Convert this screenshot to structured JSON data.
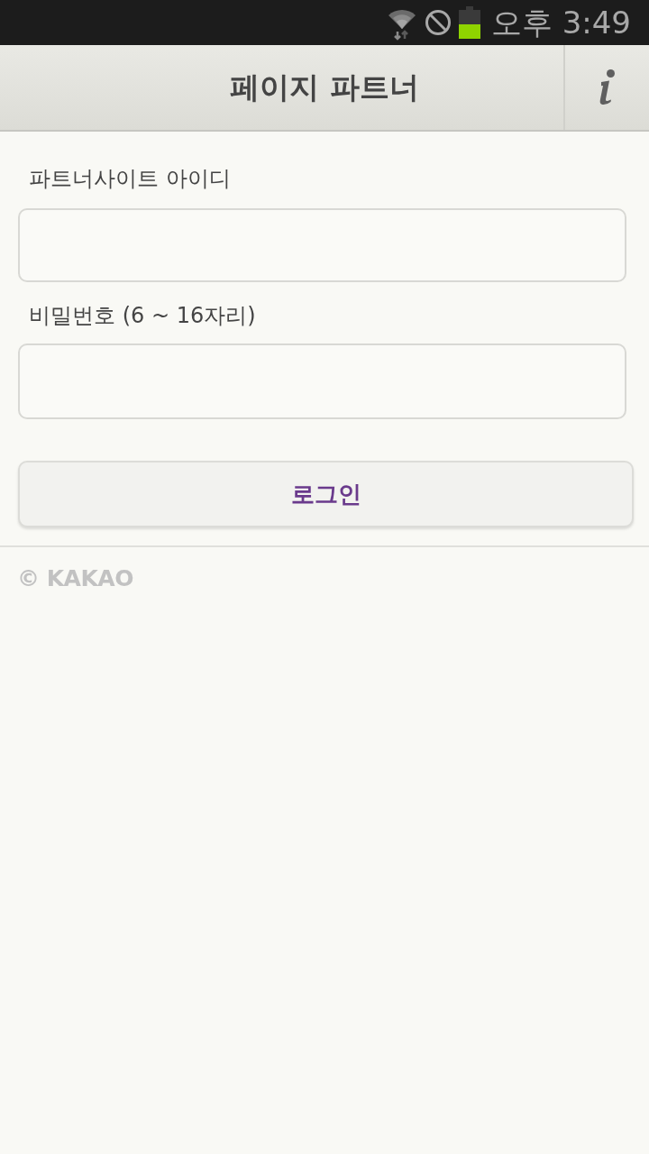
{
  "status_bar": {
    "time": "오후 3:49"
  },
  "header": {
    "title": "페이지 파트너"
  },
  "form": {
    "fields": [
      {
        "label": "파트너사이트 아이디"
      },
      {
        "label": "비밀번호 (6 ~ 16자리)"
      }
    ],
    "login_button": "로그인"
  },
  "footer": {
    "copyright": "© KAKAO"
  }
}
